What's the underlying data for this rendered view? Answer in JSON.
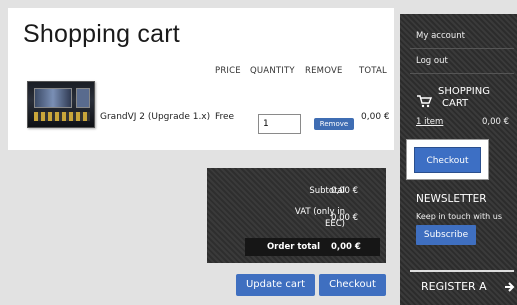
{
  "page_title": "Shopping cart",
  "columns": {
    "price": "PRICE",
    "quantity": "QUANTITY",
    "remove": "REMOVE",
    "total": "TOTAL"
  },
  "item": {
    "name": "GrandVJ 2 (Upgrade 1.x)",
    "price": "Free",
    "quantity": "1",
    "remove_label": "Remove",
    "total": "0,00 €"
  },
  "totals": {
    "subtotal_label": "Subtotal",
    "subtotal_value": "0,00 €",
    "vat_label_1": "VAT (only in",
    "vat_label_2": "EEC)",
    "vat_value": "0,00 €",
    "order_total_label": "Order total",
    "order_total_value": "0,00 €"
  },
  "buttons": {
    "update_cart": "Update cart",
    "checkout": "Checkout"
  },
  "sidebar": {
    "my_account": "My account",
    "log_out": "Log out",
    "cart_title_1": "SHOPPING",
    "cart_title_2": "CART",
    "cart_count": "1 item",
    "cart_total": "0,00 €",
    "checkout": "Checkout",
    "newsletter_title": "NEWSLETTER",
    "newsletter_text": "Keep in touch with us",
    "subscribe": "Subscribe",
    "register": "REGISTER A"
  },
  "colors": {
    "accent": "#3f6fc0",
    "sidebar_bg": "#333333",
    "page_bg": "#e2e2e2"
  }
}
